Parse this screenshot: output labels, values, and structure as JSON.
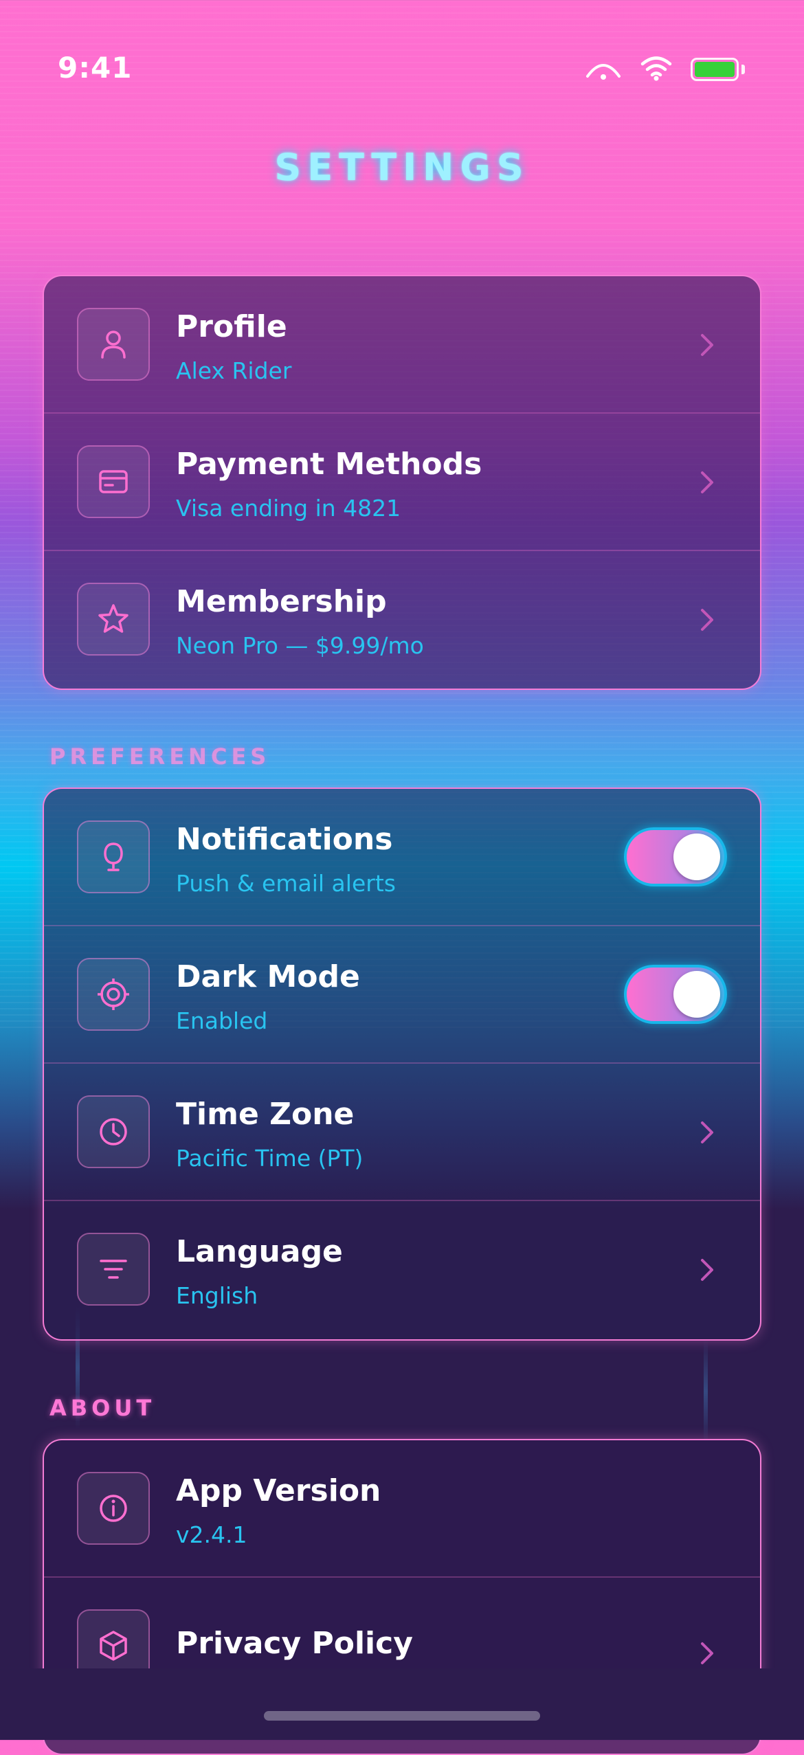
{
  "status_bar": {
    "time": "9:41"
  },
  "header": {
    "title": "SETTINGS"
  },
  "account": {
    "items": [
      {
        "title": "Profile",
        "subtitle": "Alex Rider",
        "icon": "user-icon"
      },
      {
        "title": "Payment Methods",
        "subtitle": "Visa ending in 4821",
        "icon": "credit-card-icon"
      },
      {
        "title": "Membership",
        "subtitle": "Neon Pro — $9.99/mo",
        "icon": "star-icon"
      }
    ]
  },
  "preferences": {
    "label": "PREFERENCES",
    "items": [
      {
        "title": "Notifications",
        "subtitle": "Push & email alerts",
        "icon": "bell-icon",
        "toggle": true
      },
      {
        "title": "Dark Mode",
        "subtitle": "Enabled",
        "icon": "target-icon",
        "toggle": true
      },
      {
        "title": "Time Zone",
        "subtitle": "Pacific Time (PT)",
        "icon": "clock-icon"
      },
      {
        "title": "Language",
        "subtitle": "English",
        "icon": "filter-lines-icon"
      }
    ]
  },
  "about": {
    "label": "ABOUT",
    "items": [
      {
        "title": "App Version",
        "subtitle": "v2.4.1",
        "icon": "info-icon"
      },
      {
        "title": "Privacy Policy",
        "icon": "cube-icon"
      }
    ]
  },
  "colors": {
    "accent_pink": "#ff6fd0",
    "accent_cyan": "#29c4f0",
    "battery": "#37d13a"
  }
}
